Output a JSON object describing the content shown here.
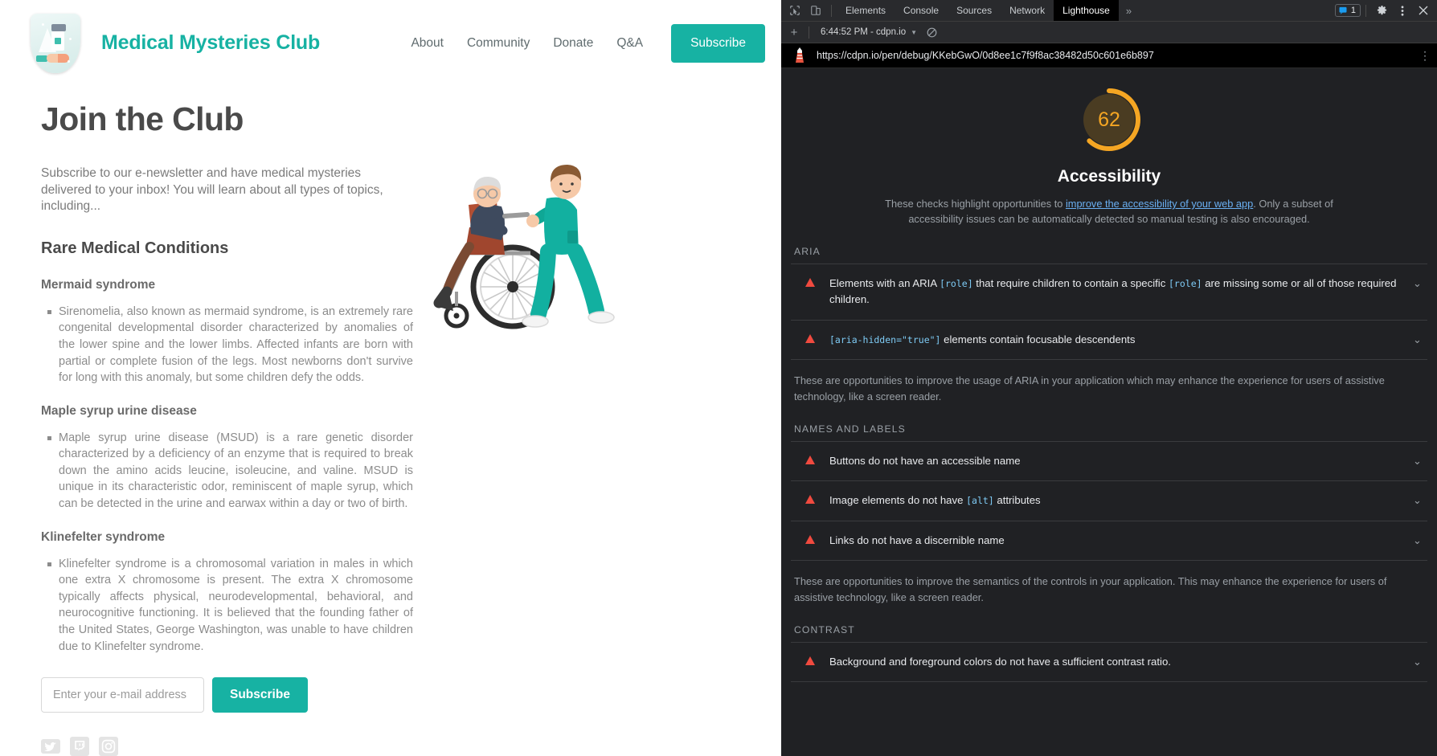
{
  "site": {
    "title": "Medical Mysteries Club",
    "logo_icon": "medical-shield-badge-icon",
    "nav": [
      {
        "label": "About"
      },
      {
        "label": "Community"
      },
      {
        "label": "Donate"
      },
      {
        "label": "Q&A"
      }
    ],
    "nav_cta": "Subscribe",
    "brand_color": "#17b2a3"
  },
  "main": {
    "page_title": "Join the Club",
    "intro": "Subscribe to our e-newsletter and have medical mysteries delivered to your inbox! You will learn about all types of topics, including...",
    "section_title": "Rare Medical Conditions",
    "conditions": [
      {
        "title": "Mermaid syndrome",
        "body": "Sirenomelia, also known as mermaid syndrome, is an extremely rare congenital developmental disorder characterized by anomalies of the lower spine and the lower limbs. Affected infants are born with partial or complete fusion of the legs. Most newborns don't survive for long with this anomaly, but some children defy the odds."
      },
      {
        "title": "Maple syrup urine disease",
        "body": "Maple syrup urine disease (MSUD) is a rare genetic disorder characterized by a deficiency of an enzyme that is required to break down the amino acids leucine, isoleucine, and valine. MSUD is unique in its characteristic odor, reminiscent of maple syrup, which can be detected in the urine and earwax within a day or two of birth."
      },
      {
        "title": "Klinefelter syndrome",
        "body": "Klinefelter syndrome is a chromosomal variation in males in which one extra X chromosome is present. The extra X chromosome typically affects physical, neurodevelopmental, behavioral, and neurocognitive functioning. It is believed that the founding father of the United States, George Washington, was unable to have children due to Klinefelter syndrome."
      }
    ],
    "form": {
      "email_placeholder": "Enter your e-mail address",
      "email_value": "",
      "submit_label": "Subscribe"
    },
    "socials": [
      {
        "name": "twitter-icon"
      },
      {
        "name": "twitch-icon"
      },
      {
        "name": "instagram-icon"
      }
    ],
    "illustration": "nurse-pushing-patient-in-wheelchair-illustration"
  },
  "devtools": {
    "tabs": [
      {
        "label": "Elements",
        "active": false
      },
      {
        "label": "Console",
        "active": false
      },
      {
        "label": "Sources",
        "active": false
      },
      {
        "label": "Network",
        "active": false
      },
      {
        "label": "Lighthouse",
        "active": true
      }
    ],
    "more_label": "»",
    "issues_count": "1",
    "subbar": {
      "new_label": "+",
      "report_select": "6:44:52 PM - cdpn.io"
    },
    "report": {
      "url": "https://cdpn.io/pen/debug/KKebGwO/0d8ee1c7f9f8ac38482d50c601e6b897",
      "score": "62",
      "score_color": "#f5a623",
      "category": "Accessibility",
      "description_pre": "These checks highlight opportunities to ",
      "description_link": "improve the accessibility of your web app",
      "description_post": ". Only a subset of accessibility issues can be automatically detected so manual testing is also encouraged.",
      "groups": [
        {
          "heading": "ARIA",
          "audits": [
            {
              "text_html": "Elements with an ARIA <code>[role]</code> that require children to contain a specific <code>[role]</code> are missing some or all of those required children."
            },
            {
              "text_html": "<code>[aria-hidden=\"true\"]</code> elements contain focusable descendents"
            }
          ],
          "footer": "These are opportunities to improve the usage of ARIA in your application which may enhance the experience for users of assistive technology, like a screen reader."
        },
        {
          "heading": "NAMES AND LABELS",
          "audits": [
            {
              "text_html": "Buttons do not have an accessible name"
            },
            {
              "text_html": "Image elements do not have <code>[alt]</code> attributes"
            },
            {
              "text_html": "Links do not have a discernible name"
            }
          ],
          "footer": "These are opportunities to improve the semantics of the controls in your application. This may enhance the experience for users of assistive technology, like a screen reader."
        },
        {
          "heading": "CONTRAST",
          "audits": [
            {
              "text_html": "Background and foreground colors do not have a sufficient contrast ratio."
            }
          ],
          "footer": ""
        }
      ]
    }
  }
}
